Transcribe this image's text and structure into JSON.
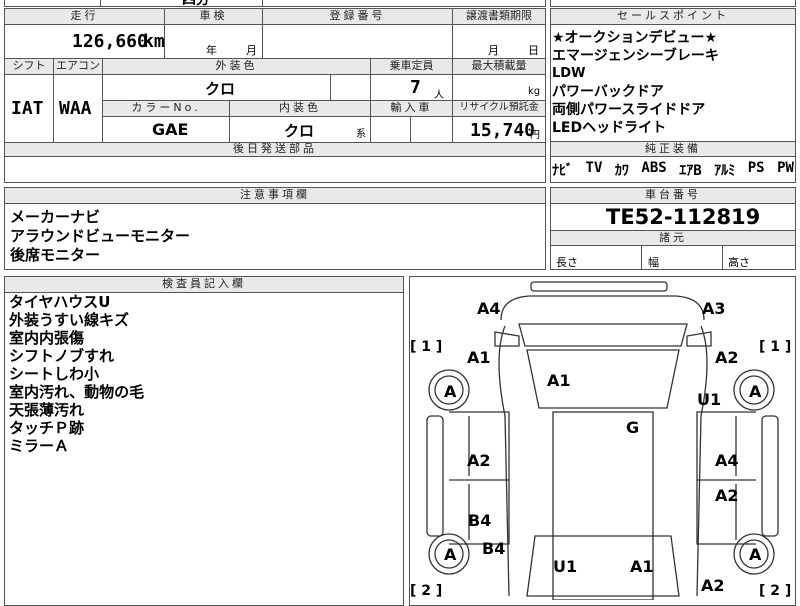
{
  "top_cut": {
    "text": "四分"
  },
  "headers": {
    "mileage": "走行",
    "inspection": "車検",
    "registration": "登録番号",
    "transfer_deadline": "譲渡書類期限",
    "sales_points": "セールスポイント",
    "shift": "シフト",
    "aircon": "エアコン",
    "exterior_color": "外装色",
    "capacity": "乗車定員",
    "max_load": "最大積載量",
    "color_no": "カラーNo.",
    "interior_color": "内装色",
    "import": "輸入車",
    "recycle": "リサイクル預託金",
    "later_parts": "後日発送部品",
    "genuine_equipment": "純正装備",
    "notes": "注意事項欄",
    "chassis_number": "車台番号",
    "dimensions": "諸元",
    "inspector": "検査員記入欄"
  },
  "values": {
    "mileage": "126,660",
    "mileage_unit": "km",
    "year_unit": "年",
    "month_unit": "月",
    "transfer_month": "月",
    "transfer_day": "日",
    "shift": "IAT",
    "aircon": "WAA",
    "exterior_color": "クロ",
    "capacity": "7",
    "capacity_unit": "人",
    "load_unit": "kg",
    "color_no": "GAE",
    "interior_color": "クロ",
    "interior_suffix": "系",
    "recycle": "15,740",
    "recycle_unit": "円",
    "chassis_number": "TE52-112819",
    "length_label": "長さ",
    "width_label": "幅",
    "height_label": "高さ"
  },
  "sales_points": [
    "★オークションデビュー★",
    "エマージェンシーブレーキ",
    "LDW",
    "パワーバックドア",
    "両側パワースライドドア",
    "LEDヘッドライト"
  ],
  "equipment": [
    "ﾅﾋﾞ",
    "TV",
    "ｶﾜ",
    "ABS",
    "ｴｱB",
    "ｱﾙﾐ",
    "PS",
    "PW"
  ],
  "notes": [
    "メーカーナビ",
    "アラウンドビューモニター",
    "後席モニター"
  ],
  "inspector_notes": [
    "タイヤハウスU",
    "外装うすい線キズ",
    "室内内張傷",
    "シフトノブすれ",
    "シートしわ小",
    "室内汚れ、動物の毛",
    "天張薄汚れ",
    "タッチＰ跡",
    "ミラーＡ"
  ],
  "diagram": {
    "marks": {
      "front_left_corner": "A4",
      "front_right_corner": "A3",
      "tag_1_left": "[ 1 ]",
      "tag_1_right": "[ 1 ]",
      "tag_2_left": "[ 2 ]",
      "tag_2_right": "[ 2 ]",
      "left_front_fender": "A1",
      "right_front_fender": "A2",
      "windshield": "A1",
      "right_tire_house": "U1",
      "roof": "G",
      "left_front_door": "A2",
      "right_front_door": "A4",
      "right_rear_door": "A2",
      "left_rear_door": "B4",
      "left_rear_fender": "B4",
      "rear_glass_left": "U1",
      "rear_glass_right": "A1",
      "right_rear_fender": "A2",
      "tire_fl": "A",
      "tire_fr": "A",
      "tire_rl": "A",
      "tire_rr": "A"
    }
  }
}
